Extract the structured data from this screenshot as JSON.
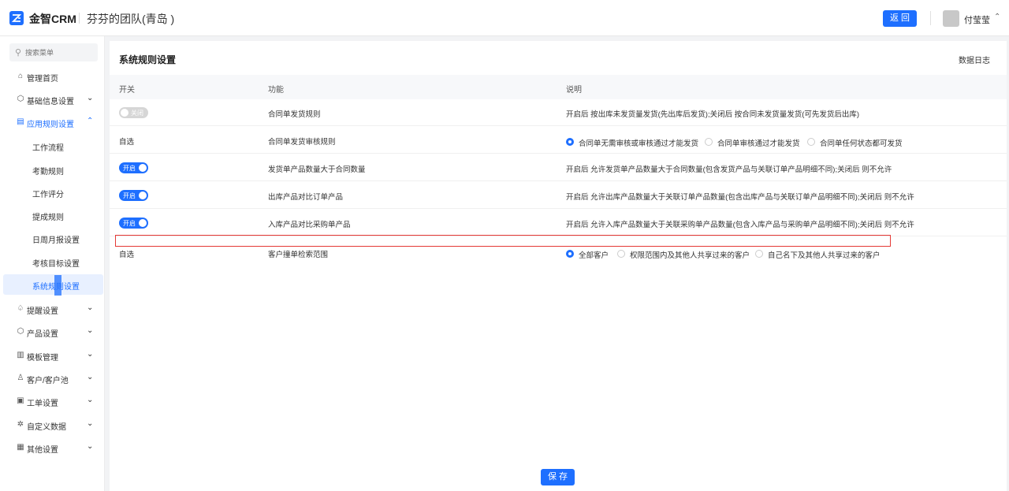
{
  "header": {
    "brand": "金智CRM",
    "team": "芬芬的团队(青岛 )",
    "back_label": "返 回",
    "user_name": "付莹莹",
    "user_caret": "⌃"
  },
  "sidebar": {
    "search_placeholder": "搜索菜单",
    "items": [
      {
        "label": "管理首页",
        "icon": "home-icon",
        "glyph": "⌂"
      },
      {
        "label": "基础信息设置",
        "icon": "cube-icon",
        "glyph": "⬡",
        "chevron": "⌄"
      },
      {
        "label": "应用规则设置",
        "icon": "document-icon",
        "glyph": "▤",
        "chevron": "⌃"
      },
      {
        "label": "提醒设置",
        "icon": "bell-icon",
        "glyph": "♤",
        "chevron": "⌄"
      },
      {
        "label": "产品设置",
        "icon": "box-icon",
        "glyph": "⬡",
        "chevron": "⌄"
      },
      {
        "label": "模板管理",
        "icon": "template-icon",
        "glyph": "▥",
        "chevron": "⌄"
      },
      {
        "label": "客户/客户池",
        "icon": "customer-icon",
        "glyph": "♙",
        "chevron": "⌄"
      },
      {
        "label": "工单设置",
        "icon": "ticket-icon",
        "glyph": "▣",
        "chevron": "⌄"
      },
      {
        "label": "自定义数据",
        "icon": "custom-data-icon",
        "glyph": "✲",
        "chevron": "⌄"
      },
      {
        "label": "其他设置",
        "icon": "grid-icon",
        "glyph": "▦",
        "chevron": "⌄"
      }
    ],
    "subitems": [
      "工作流程",
      "考勤规则",
      "工作评分",
      "提成规则",
      "日周月报设置",
      "考核目标设置",
      "系统规则设置"
    ]
  },
  "main": {
    "title": "系统规则设置",
    "log_link": "数据日志",
    "columns": [
      "开关",
      "功能",
      "说明"
    ],
    "rows": [
      {
        "switch": "关闭",
        "feature": "合同单发货规则",
        "desc": "开启后 按出库未发货量发货(先出库后发货);关闭后 按合同未发货量发货(可先发货后出库)"
      },
      {
        "switch_text": "自选",
        "feature": "合同单发货审核规则",
        "options": [
          "合同单无需审核或审核通过才能发货",
          "合同单审核通过才能发货",
          "合同单任何状态都可发货"
        ]
      },
      {
        "switch": "开启",
        "feature": "发货单产品数量大于合同数量",
        "desc": "开启后 允许发货单产品数量大于合同数量(包含发货产品与关联订单产品明细不同);关闭后 则不允许"
      },
      {
        "switch": "开启",
        "feature": "出库产品对比订单产品",
        "desc": "开启后 允许出库产品数量大于关联订单产品数量(包含出库产品与关联订单产品明细不同);关闭后 则不允许"
      },
      {
        "switch": "开启",
        "feature": "入库产品对比采购单产品",
        "desc": "开启后 允许入库产品数量大于关联采购单产品数量(包含入库产品与采购单产品明细不同);关闭后 则不允许"
      },
      {
        "switch_text": "自选",
        "feature": "客户撞单检索范围",
        "options": [
          "全部客户",
          "权限范围内及其他人共享过来的客户",
          "自己名下及其他人共享过来的客户"
        ]
      }
    ],
    "save_label": "保 存"
  },
  "colors": {
    "accent": "#1e6fff",
    "highlight": "#e53935"
  }
}
